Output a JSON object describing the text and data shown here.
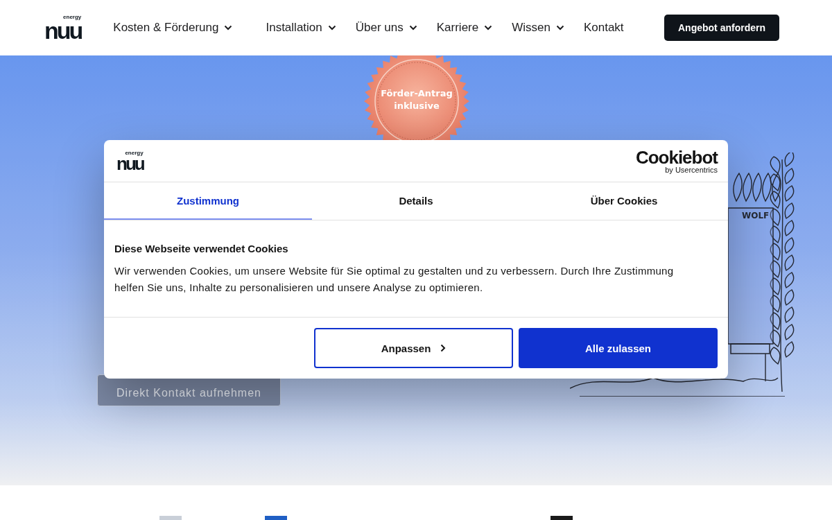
{
  "header": {
    "logo": {
      "wordmark": "nuu",
      "tagline": "energy"
    },
    "nav": [
      {
        "label": "Kosten & Förderung",
        "dropdown": true
      },
      {
        "label": "Installation",
        "dropdown": true
      },
      {
        "label": "Über uns",
        "dropdown": true
      },
      {
        "label": "Karriere",
        "dropdown": true
      },
      {
        "label": "Wissen",
        "dropdown": true
      },
      {
        "label": "Kontakt",
        "dropdown": false
      }
    ],
    "cta": "Angebot anfordern"
  },
  "hero": {
    "badge": [
      "Förder-Antrag",
      "inklusive"
    ],
    "contact_button": "Direkt Kontakt aufnehmen",
    "illustration_label": "WOLF"
  },
  "cookie_dialog": {
    "logo": {
      "wordmark": "nuu",
      "tagline": "energy"
    },
    "provider": {
      "name": "Cookiebot",
      "by": "by Usercentrics"
    },
    "tabs": [
      {
        "label": "Zustimmung",
        "selected": true
      },
      {
        "label": "Details",
        "selected": false
      },
      {
        "label": "Über Cookies",
        "selected": false
      }
    ],
    "heading": "Diese Webseite verwendet Cookies",
    "text": "Wir verwenden Cookies, um unsere Website für Sie optimal zu gestalten und zu verbessern. Durch Ihre Zustimmung helfen Sie uns, Inhalte zu personalisieren und unsere Analyse zu optimieren.",
    "buttons": [
      {
        "label": "Anpassen",
        "kind": "outline"
      },
      {
        "label": "Alle zulassen",
        "kind": "primary"
      }
    ]
  }
}
